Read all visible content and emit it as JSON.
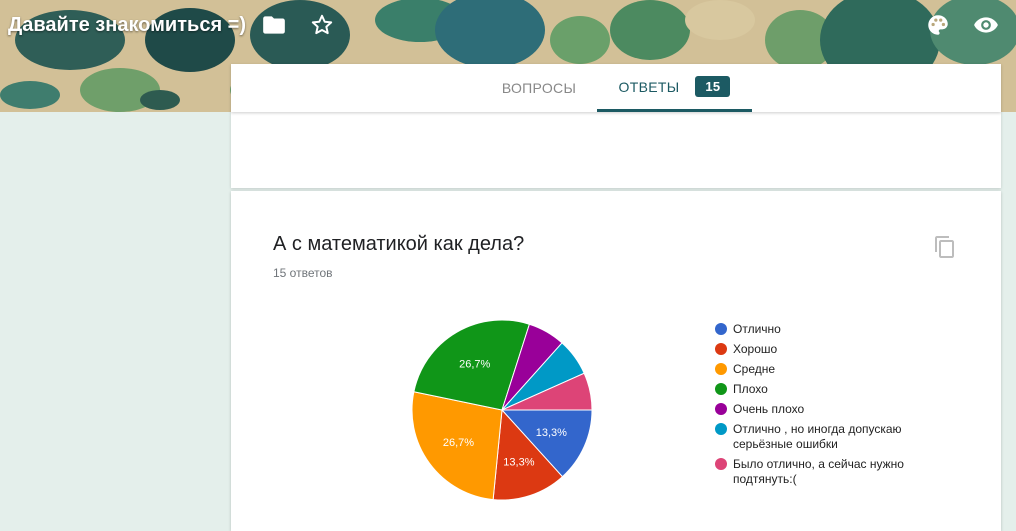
{
  "header": {
    "title": "Давайте знакомиться =)",
    "icons": [
      "folder-icon",
      "star-icon",
      "palette-icon",
      "eye-icon"
    ]
  },
  "tabs": [
    {
      "label": "ВОПРОСЫ",
      "active": false
    },
    {
      "label": "ОТВЕТЫ",
      "active": true,
      "badge": "15"
    }
  ],
  "question": {
    "title": "А с математикой как дела?",
    "count": "15 ответов"
  },
  "colors": {
    "accent": "#1c5a63",
    "background": "#e4efeb"
  },
  "chart_data": {
    "type": "pie",
    "slices": [
      {
        "label": "Отлично",
        "value": 13.3,
        "color": "#3366cc",
        "label_text": "13,3%"
      },
      {
        "label": "Хорошо",
        "value": 13.3,
        "color": "#dc3912",
        "label_text": "13,3%"
      },
      {
        "label": "Средне",
        "value": 26.7,
        "color": "#ff9900",
        "label_text": "26,7%"
      },
      {
        "label": "Плохо",
        "value": 26.7,
        "color": "#109618",
        "label_text": "26,7%"
      },
      {
        "label": "Очень плохо",
        "value": 6.7,
        "color": "#990099",
        "label_text": ""
      },
      {
        "label": "Отлично , но иногда допускаю серьёзные ошибки",
        "value": 6.7,
        "color": "#0099c6",
        "label_text": ""
      },
      {
        "label": "Было отлично, а сейчас нужно подтянуть:(",
        "value": 6.7,
        "color": "#dd4477",
        "label_text": ""
      }
    ],
    "legend_position": "right"
  }
}
